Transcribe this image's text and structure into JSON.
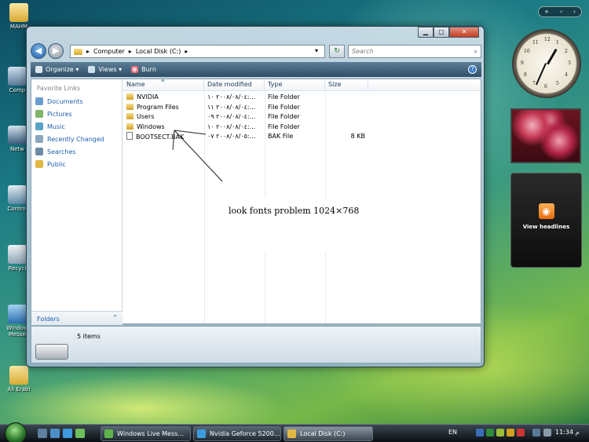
{
  "desktop": {
    "icons": [
      "MAHM",
      "Comp",
      "Netw",
      "Control",
      "Recycl",
      "Window Messe",
      "Ali Erabi"
    ]
  },
  "window": {
    "controls": {
      "minimize": "▁",
      "maximize": "▢",
      "close": "✕"
    }
  },
  "address": {
    "parts": [
      "Computer",
      "Local Disk (C:)"
    ],
    "search_placeholder": "Search"
  },
  "toolbar": {
    "organize": "Organize",
    "views": "Views",
    "burn": "Burn",
    "help": "?"
  },
  "nav": {
    "header": "Favorite Links",
    "links": [
      "Documents",
      "Pictures",
      "Music",
      "Recently Changed",
      "Searches",
      "Public"
    ],
    "folders": "Folders"
  },
  "columns": {
    "name": "Name",
    "date": "Date modified",
    "type": "Type",
    "size": "Size"
  },
  "files": [
    {
      "name": "NVIDIA",
      "date": "٢٠٠٨/٠٨/٠٤ ١٠:...",
      "type": "File Folder",
      "size": ""
    },
    {
      "name": "Program Files",
      "date": "٢٠٠٨/٠٨/٠٤ ١١:...",
      "type": "File Folder",
      "size": ""
    },
    {
      "name": "Users",
      "date": "٢٠٠٨/٠٨/٠٤ ٠٩:...",
      "type": "File Folder",
      "size": ""
    },
    {
      "name": "Windows",
      "date": "٢٠٠٨/٠٨/٠٤ ١٠:...",
      "type": "File Folder",
      "size": ""
    },
    {
      "name": "BOOTSECT.BAK",
      "date": "٢٠٠٨/٠٨/٠٥ ٠٧:...",
      "type": "BAK File",
      "size": "8 KB"
    }
  ],
  "annotation": "look fonts problem 1024×768",
  "details": {
    "count": "5 items"
  },
  "sidebar": {
    "feed_label": "View headlines",
    "clock_numbers": [
      "12",
      "1",
      "2",
      "3",
      "4",
      "5",
      "6",
      "7",
      "8",
      "9",
      "10",
      "11"
    ]
  },
  "taskbar": {
    "tasks": [
      "Windows Live Mess...",
      "Nvidia Geforce 5200...",
      "Local Disk (C:)"
    ],
    "lang": "EN",
    "time": "11:34 م"
  }
}
